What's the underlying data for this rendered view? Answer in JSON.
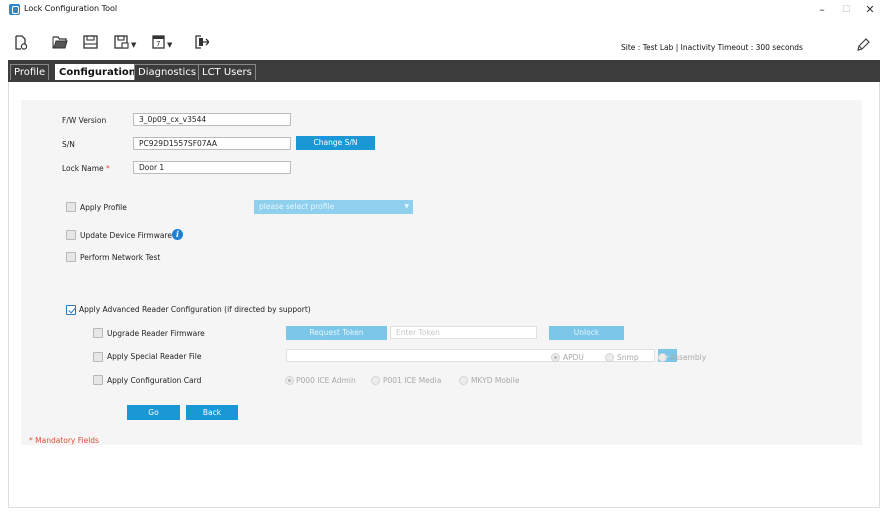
{
  "window": {
    "title": "Lock Configuration Tool",
    "minimize": "–",
    "maximize": "☐",
    "close": "✕"
  },
  "toolbar": {
    "icons": [
      "new-file-icon",
      "open-folder-icon",
      "save-icon",
      "save-as-icon",
      "template-icon",
      "export-icon"
    ],
    "site_info": "Site : Test Lab   |   Inactivity Timeout : 300 seconds",
    "edit_icon": "pencil-icon"
  },
  "tabs": [
    {
      "label": "Profile",
      "active": false
    },
    {
      "label": "Configuration",
      "active": true
    },
    {
      "label": "Diagnostics",
      "active": false
    },
    {
      "label": "LCT Users",
      "active": false
    }
  ],
  "form": {
    "fw_label": "F/W Version",
    "fw_value": "3_0p09_cx_v3544",
    "sn_label": "S/N",
    "sn_value": "PC929D1557SF07AA",
    "change_sn": "Change S/N",
    "lock_name_label": "Lock Name",
    "required_mark": "*",
    "lock_name_value": "Door 1",
    "apply_profile": "Apply Profile",
    "profile_placeholder": "please select profile",
    "update_firmware": "Update Device Firmware",
    "network_test": "Perform Network Test",
    "advanced": "Apply Advanced Reader Configuration (if directed by support)",
    "upgrade_reader": "Upgrade Reader Firmware",
    "request_token": "Request Token",
    "token_placeholder": "Enter Token",
    "unlock": "Unlock",
    "special_file": "Apply Special Reader File",
    "browse": "...",
    "apdu": "APDU",
    "snmp": "Snmp",
    "assembly": "Assembly",
    "config_card": "Apply Configuration Card",
    "p000": "P000 ICE Admin",
    "p001": "P001 ICE Media",
    "mkyd": "MKYD Mobile",
    "go": "Go",
    "back": "Back",
    "mandatory": "* Mandatory Fields"
  },
  "colors": {
    "accent": "#1a98d5",
    "accent_disabled": "#7cc6ea",
    "tab_bar": "#3c3c3c",
    "required": "#e04e3a"
  }
}
